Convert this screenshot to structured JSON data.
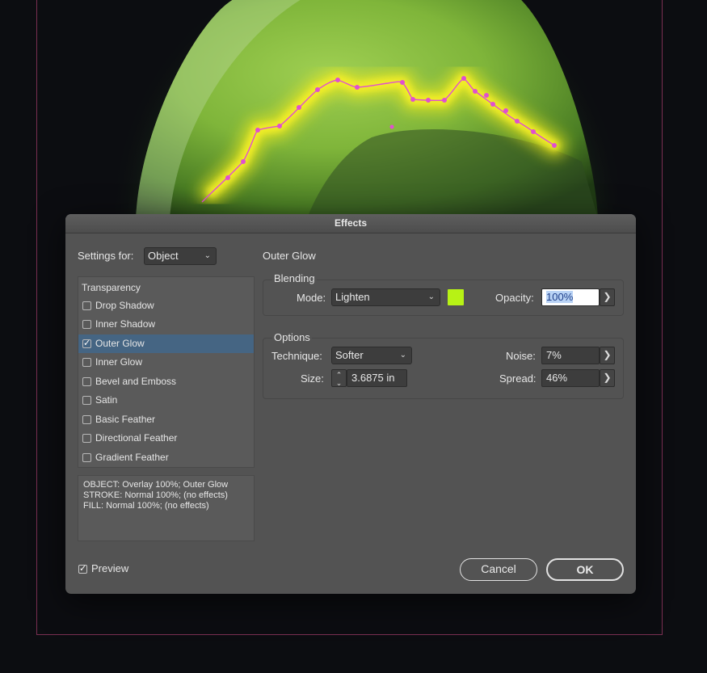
{
  "dialog": {
    "title": "Effects",
    "settings_for": {
      "label": "Settings for:",
      "value": "Object"
    },
    "effects_list": {
      "header": "Transparency",
      "items": [
        {
          "label": "Drop Shadow",
          "checked": false
        },
        {
          "label": "Inner Shadow",
          "checked": false
        },
        {
          "label": "Outer Glow",
          "checked": true,
          "selected": true
        },
        {
          "label": "Inner Glow",
          "checked": false
        },
        {
          "label": "Bevel and Emboss",
          "checked": false
        },
        {
          "label": "Satin",
          "checked": false
        },
        {
          "label": "Basic Feather",
          "checked": false
        },
        {
          "label": "Directional Feather",
          "checked": false
        },
        {
          "label": "Gradient Feather",
          "checked": false
        }
      ]
    },
    "summary": [
      "OBJECT: Overlay 100%; Outer Glow",
      "STROKE: Normal 100%; (no effects)",
      "FILL: Normal 100%; (no effects)"
    ],
    "panel_title": "Outer Glow",
    "blending": {
      "title": "Blending",
      "mode_label": "Mode:",
      "mode_value": "Lighten",
      "glow_color": "#b7f215",
      "opacity_label": "Opacity:",
      "opacity_value": "100%"
    },
    "options": {
      "title": "Options",
      "technique_label": "Technique:",
      "technique_value": "Softer",
      "size_label": "Size:",
      "size_value": "3.6875 in",
      "noise_label": "Noise:",
      "noise_value": "7%",
      "spread_label": "Spread:",
      "spread_value": "46%"
    },
    "preview": {
      "label": "Preview",
      "checked": true
    },
    "buttons": {
      "cancel": "Cancel",
      "ok": "OK"
    }
  },
  "icons": {
    "dropdown": "chevron-down-icon",
    "stepper": "stepper-icon",
    "flyout": "chevron-right-icon"
  },
  "colors": {
    "dialog_bg": "#535353",
    "selection": "#456583",
    "glow": "#f0ea1a",
    "path_points": "#e04fd0"
  }
}
